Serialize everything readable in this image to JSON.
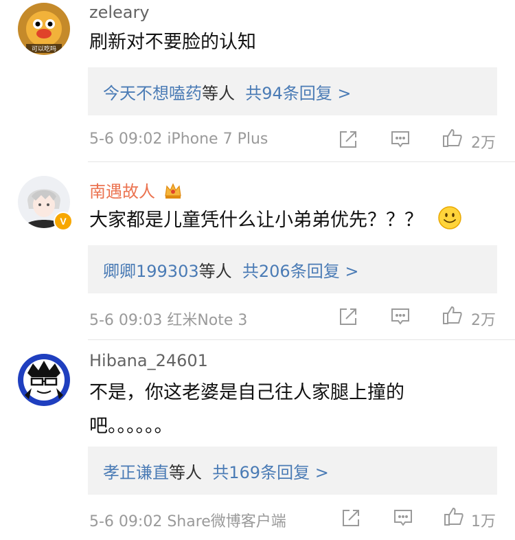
{
  "comments": [
    {
      "username": "zeleary",
      "text_lines": [
        "刷新对不要脸的认知"
      ],
      "reply_names": "今天不想嗑药",
      "reply_mid": "等人",
      "reply_total": "共94条回复 >",
      "meta": "5-6 09:02 iPhone 7 Plus",
      "likes": "2万",
      "avatar_text": "可以吃吗"
    },
    {
      "username": "南遇故人",
      "text_lines": [
        "大家都是儿童凭什么让小弟弟优先？？？"
      ],
      "reply_names": "卿卿199303",
      "reply_mid": "等人",
      "reply_total": "共206条回复 >",
      "meta": "5-6 09:03 红米Note 3",
      "likes": "2万",
      "badge": "V"
    },
    {
      "username": "Hibana_24601",
      "text_lines": [
        "不是，你这老婆是自己往人家腿上撞的",
        "吧。。。。。。"
      ],
      "reply_names": "孝正谦直",
      "reply_mid": "等人",
      "reply_total": "共169条回复 >",
      "meta": "5-6 09:02 Share微博客户端",
      "likes": "1万"
    }
  ],
  "colors": {
    "link_blue": "#4a7bb5",
    "vip_orange": "#eb7350",
    "meta_gray": "#9a9a9a",
    "reply_bg": "#f2f2f2"
  },
  "icons": [
    "share-icon",
    "comment-icon",
    "like-icon",
    "crown-icon",
    "smile-emoji"
  ]
}
